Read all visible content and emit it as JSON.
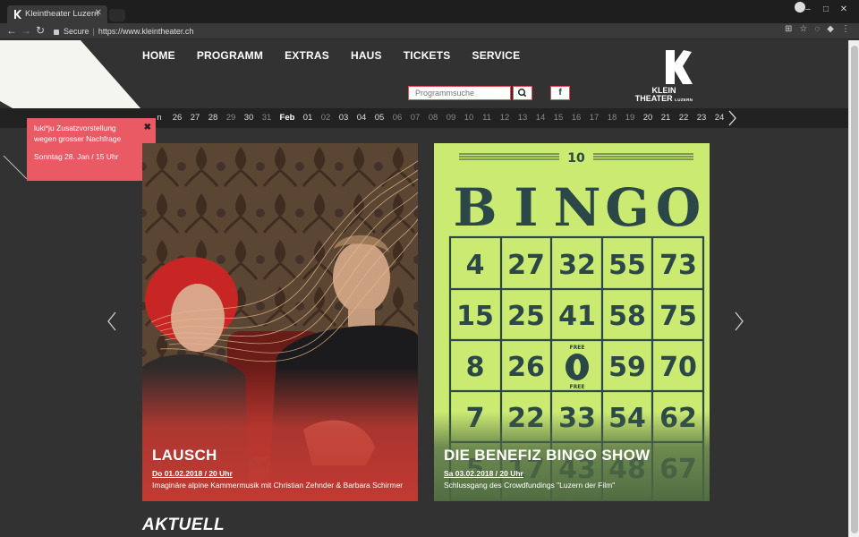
{
  "browser": {
    "tab_title": "Kleintheater Luzern",
    "secure_label": "Secure",
    "url": "https://www.kleintheater.ch"
  },
  "nav": {
    "items": [
      "HOME",
      "PROGRAMM",
      "EXTRAS",
      "HAUS",
      "TICKETS",
      "SERVICE"
    ]
  },
  "search": {
    "placeholder": "Programmsuche"
  },
  "social": {
    "facebook": "f"
  },
  "logo": {
    "line1": "KLEIN",
    "line2": "THEATER",
    "line3": "LUZERN"
  },
  "date_strip": {
    "days": [
      {
        "label": "n",
        "style": "light"
      },
      {
        "label": "26",
        "style": "light"
      },
      {
        "label": "27",
        "style": "light"
      },
      {
        "label": "28",
        "style": "light"
      },
      {
        "label": "29",
        "style": ""
      },
      {
        "label": "30",
        "style": "light"
      },
      {
        "label": "31",
        "style": ""
      },
      {
        "label": "Feb",
        "style": "bold"
      },
      {
        "label": "01",
        "style": "light"
      },
      {
        "label": "02",
        "style": ""
      },
      {
        "label": "03",
        "style": "light"
      },
      {
        "label": "04",
        "style": "light"
      },
      {
        "label": "05",
        "style": "light"
      },
      {
        "label": "06",
        "style": ""
      },
      {
        "label": "07",
        "style": ""
      },
      {
        "label": "08",
        "style": ""
      },
      {
        "label": "09",
        "style": ""
      },
      {
        "label": "10",
        "style": ""
      },
      {
        "label": "11",
        "style": ""
      },
      {
        "label": "12",
        "style": ""
      },
      {
        "label": "13",
        "style": ""
      },
      {
        "label": "14",
        "style": ""
      },
      {
        "label": "15",
        "style": ""
      },
      {
        "label": "16",
        "style": ""
      },
      {
        "label": "17",
        "style": ""
      },
      {
        "label": "18",
        "style": ""
      },
      {
        "label": "19",
        "style": ""
      },
      {
        "label": "20",
        "style": "light"
      },
      {
        "label": "21",
        "style": "light"
      },
      {
        "label": "22",
        "style": "light"
      },
      {
        "label": "23",
        "style": "light"
      },
      {
        "label": "24",
        "style": "light"
      }
    ]
  },
  "notice": {
    "text": "luki*ju Zusatzvorstellung wegen grosser Nachfrage",
    "date": "Sonntag 28. Jan / 15 Uhr",
    "close": "✖"
  },
  "cards": [
    {
      "title": "LAUSCH",
      "date": "Do 01.02.2018 / 20 Uhr",
      "description": "Imaginäre alpine Kammermusik mit Christian Zehnder & Barbara Schirmer"
    },
    {
      "title": "DIE BENEFIZ BINGO SHOW",
      "date": "Sa 03.02.2018 / 20 Uhr",
      "description": "Schlussgang des Crowdfundings \"Luzern der Film\""
    }
  ],
  "bingo": {
    "number": "10",
    "header": [
      "B",
      "I",
      "N",
      "G",
      "O"
    ],
    "rows": [
      [
        "4",
        "27",
        "32",
        "55",
        "73"
      ],
      [
        "15",
        "25",
        "41",
        "58",
        "75"
      ],
      [
        "8",
        "26",
        "FREE",
        "59",
        "70"
      ],
      [
        "7",
        "22",
        "33",
        "54",
        "62"
      ],
      [
        "5",
        "17",
        "43",
        "48",
        "67"
      ]
    ],
    "free_label": "FREE"
  },
  "section": {
    "aktuell": "AKTUELL"
  },
  "colors": {
    "accent": "#e95a64",
    "background": "#323232",
    "lausch_overlay": "#c23a32",
    "bingo_green": "#cbea72",
    "bingo_ink": "#2b4748"
  }
}
